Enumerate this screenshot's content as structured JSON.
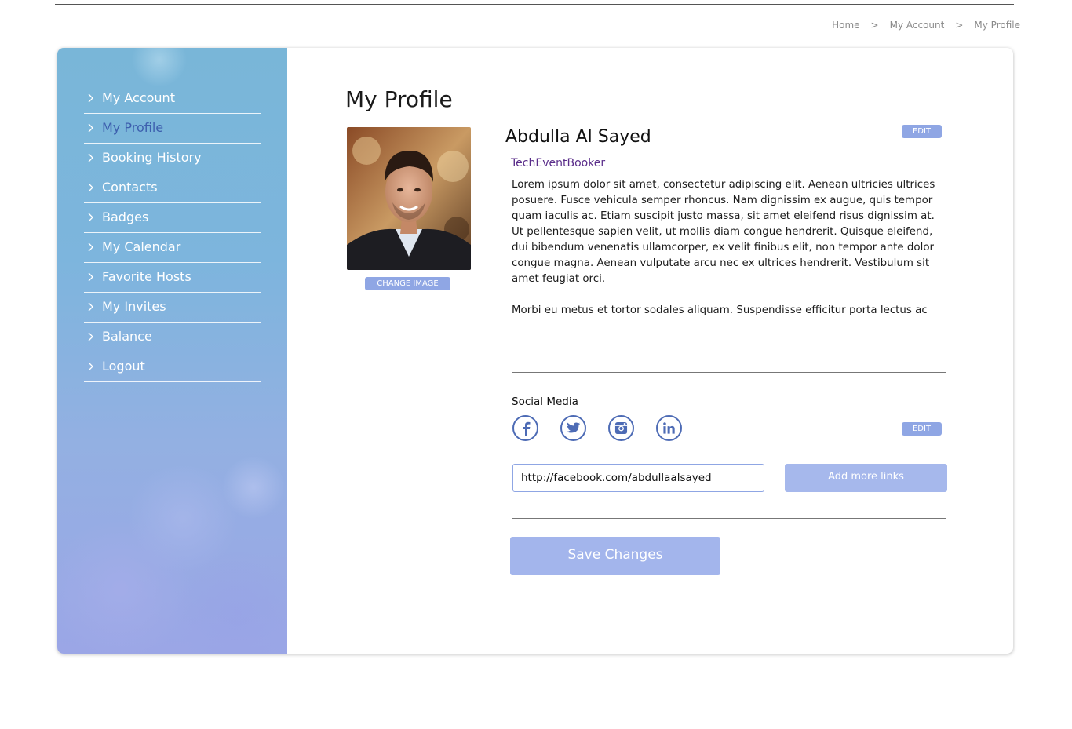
{
  "breadcrumb": [
    "Home",
    "My Account",
    "My Profile"
  ],
  "breadcrumb_separator": ">",
  "sidebar": {
    "items": [
      {
        "label": "My Account",
        "active": false
      },
      {
        "label": "My Profile",
        "active": true
      },
      {
        "label": "Booking History",
        "active": false
      },
      {
        "label": "Contacts",
        "active": false
      },
      {
        "label": "Badges",
        "active": false
      },
      {
        "label": "My Calendar",
        "active": false
      },
      {
        "label": "Favorite Hosts",
        "active": false
      },
      {
        "label": "My Invites",
        "active": false
      },
      {
        "label": "Balance",
        "active": false
      },
      {
        "label": "Logout",
        "active": false
      }
    ]
  },
  "profile": {
    "page_title": "My Profile",
    "name": "Abdulla Al Sayed",
    "company": "TechEventBooker",
    "edit_label": "EDIT",
    "change_image_label": "CHANGE IMAGE",
    "bio": [
      "Lorem ipsum dolor sit amet, consectetur adipiscing elit. Aenean ultricies ultrices posuere. Fusce vehicula semper rhoncus. Nam dignissim ex augue, quis tempor quam iaculis ac. Etiam suscipit justo massa, sit amet eleifend risus dignissim at. Ut pellentesque sapien velit, ut mollis diam congue hendrerit. Quisque eleifend, dui bibendum venenatis ullamcorper, ex velit finibus elit, non tempor ante dolor congue magna. Aenean vulputate arcu nec ex ultrices hendrerit. Vestibulum sit amet feugiat orci.",
      "Morbi eu metus et tortor sodales aliquam. Suspendisse efficitur porta lectus ac"
    ]
  },
  "social": {
    "title": "Social Media",
    "edit_label": "EDIT",
    "icons": [
      "facebook-icon",
      "twitter-icon",
      "instagram-icon",
      "linkedin-icon"
    ],
    "url_value": "http://facebook.com/abdullaalsayed",
    "add_more_label": "Add more links"
  },
  "actions": {
    "save_label": "Save Changes"
  },
  "colors": {
    "accent": "#8fa6e4",
    "active_nav": "#3d5fae",
    "company": "#5a2d8a",
    "icon_stroke": "#4d6bb5"
  }
}
